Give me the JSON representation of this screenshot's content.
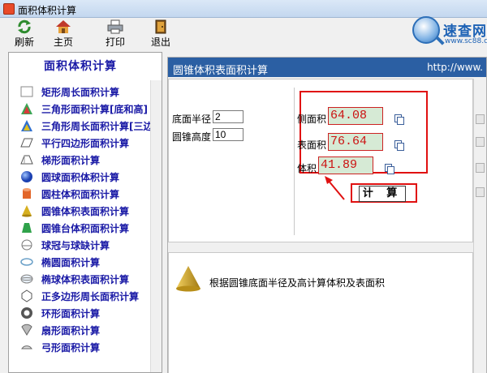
{
  "window": {
    "title": "面积体积计算"
  },
  "logo": {
    "name": "速查网",
    "url": "www.sc88.com"
  },
  "toolbar": [
    {
      "label": "刷新",
      "icon": "refresh-icon"
    },
    {
      "label": "主页",
      "icon": "home-icon"
    },
    {
      "label": "打印",
      "icon": "printer-icon"
    },
    {
      "label": "退出",
      "icon": "exit-icon"
    }
  ],
  "sidebar": {
    "heading": "面积体积计算",
    "items": [
      {
        "label": "矩形周长面积计算",
        "icon": "rectangle-icon"
      },
      {
        "label": "三角形面积计算[底和高]",
        "icon": "triangle-icon"
      },
      {
        "label": "三角形周长面积计算[三边]",
        "icon": "triangle-color-icon"
      },
      {
        "label": "平行四边形面积计算",
        "icon": "parallelogram-icon"
      },
      {
        "label": "梯形面积计算",
        "icon": "trapezoid-icon"
      },
      {
        "label": "圆球面积体积计算",
        "icon": "sphere-icon"
      },
      {
        "label": "圆柱体积面积计算",
        "icon": "cylinder-icon"
      },
      {
        "label": "圆锥体积表面积计算",
        "icon": "cone-icon"
      },
      {
        "label": "圆锥台体积面积计算",
        "icon": "frustum-icon"
      },
      {
        "label": "球冠与球缺计算",
        "icon": "spherical-cap-icon"
      },
      {
        "label": "椭圆面积计算",
        "icon": "ellipse-icon"
      },
      {
        "label": "椭球体积表面积计算",
        "icon": "ellipsoid-icon"
      },
      {
        "label": "正多边形周长面积计算",
        "icon": "polygon-icon"
      },
      {
        "label": "环形面积计算",
        "icon": "ring-icon"
      },
      {
        "label": "扇形面积计算",
        "icon": "sector-icon"
      },
      {
        "label": "弓形面积计算",
        "icon": "segment-icon"
      }
    ]
  },
  "panel": {
    "title": "圆锥体积表面积计算",
    "url": "http://www."
  },
  "form": {
    "radius_label": "底面半径",
    "radius_value": "2",
    "height_label": "圆锥高度",
    "height_value": "10"
  },
  "results": {
    "lateral_label": "侧面积",
    "lateral_value": "64.08",
    "surface_label": "表面积",
    "surface_value": "76.64",
    "volume_label": "体积",
    "volume_value": "41.89",
    "calc_label": "计 算"
  },
  "description": "根据圆锥底面半径及高计算体积及表面积",
  "colors": {
    "accent": "#2b5fa3",
    "highlight": "#e01010",
    "list_text": "#1a1aa6"
  }
}
